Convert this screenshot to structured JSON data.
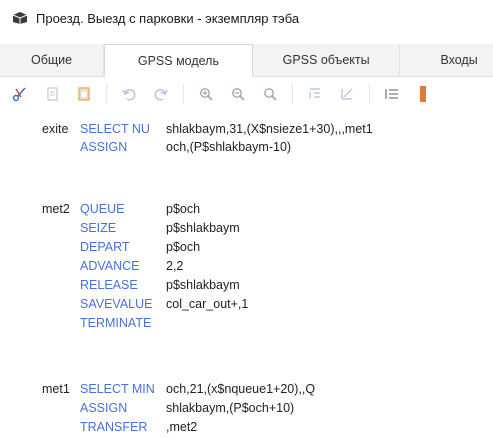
{
  "window": {
    "title": "Проезд. Выезд с парковки - экземпляр тэба",
    "icon": "gpss-app-icon"
  },
  "tabs": [
    {
      "label": "Общие",
      "active": false
    },
    {
      "label": "GPSS модель",
      "active": true
    },
    {
      "label": "GPSS объекты",
      "active": false
    },
    {
      "label": "Входы",
      "active": false
    }
  ],
  "toolbar": {
    "buttons": [
      {
        "name": "cut-icon"
      },
      {
        "name": "copy-icon"
      },
      {
        "name": "paste-icon"
      },
      {
        "name": "undo-icon"
      },
      {
        "name": "redo-icon"
      },
      {
        "name": "zoom-in-icon"
      },
      {
        "name": "zoom-out-icon"
      },
      {
        "name": "zoom-reset-icon"
      },
      {
        "name": "indent-icon"
      },
      {
        "name": "comment-icon"
      },
      {
        "name": "list-icon"
      }
    ]
  },
  "code": {
    "block1": [
      {
        "label": "exite",
        "op": "SELECT NU",
        "args": "shlakbaym,31,(X$nsieze1+30),,,met1"
      },
      {
        "label": "",
        "op": "ASSIGN",
        "args": "och,(P$shlakbaym-10)"
      }
    ],
    "block2": [
      {
        "label": "met2",
        "op": "QUEUE",
        "args": "p$och"
      },
      {
        "label": "",
        "op": "SEIZE",
        "args": "p$shlakbaym"
      },
      {
        "label": "",
        "op": "DEPART",
        "args": "p$och"
      },
      {
        "label": "",
        "op": "ADVANCE",
        "args": "2,2"
      },
      {
        "label": "",
        "op": "RELEASE",
        "args": "p$shlakbaym"
      },
      {
        "label": "",
        "op": "SAVEVALUE",
        "args": "col_car_out+,1"
      },
      {
        "label": "",
        "op": "TERMINATE",
        "args": ""
      }
    ],
    "block3": [
      {
        "label": "met1",
        "op": "SELECT MIN",
        "args": "och,21,(x$nqueue1+20),,Q"
      },
      {
        "label": "",
        "op": "ASSIGN",
        "args": "shlakbaym,(P$och+10)"
      },
      {
        "label": "",
        "op": "TRANSFER",
        "args": ",met2"
      }
    ]
  },
  "colors": {
    "keyword": "#4a6fd8",
    "text": "#222222"
  }
}
